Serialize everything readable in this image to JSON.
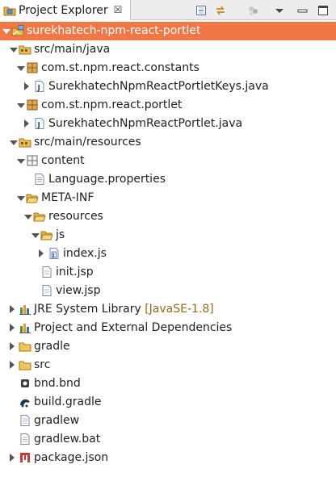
{
  "view": {
    "tab_title": "Project Explorer",
    "tab_close": "☒",
    "toolbar": [
      {
        "name": "collapse-all-button",
        "icon": "collapse-all-icon"
      },
      {
        "name": "link-with-editor-button",
        "icon": "link-editor-icon"
      },
      {
        "name": "focus-active-task-button",
        "icon": "task-focus-icon"
      },
      {
        "name": "view-menu-button",
        "icon": "chevron-down-icon"
      },
      {
        "name": "minimize-button",
        "icon": "minimize-icon"
      },
      {
        "name": "maximize-button",
        "icon": "maximize-icon"
      }
    ]
  },
  "tree": [
    {
      "label": "surekhatech-npm-react-portlet",
      "icon": "project-icon",
      "depth": 0,
      "state": "expanded",
      "selected": true
    },
    {
      "label": "src/main/java",
      "icon": "source-folder-icon",
      "depth": 1,
      "state": "expanded"
    },
    {
      "label": "com.st.npm.react.constants",
      "icon": "package-icon",
      "depth": 2,
      "state": "expanded"
    },
    {
      "label": "SurekhatechNpmReactPortletKeys.java",
      "icon": "java-file-icon",
      "depth": 3,
      "state": "collapsed"
    },
    {
      "label": "com.st.npm.react.portlet",
      "icon": "package-icon",
      "depth": 2,
      "state": "expanded"
    },
    {
      "label": "SurekhatechNpmReactPortlet.java",
      "icon": "java-file-icon",
      "depth": 3,
      "state": "collapsed"
    },
    {
      "label": "src/main/resources",
      "icon": "source-folder-icon",
      "depth": 1,
      "state": "expanded"
    },
    {
      "label": "content",
      "icon": "resource-package-icon",
      "depth": 2,
      "state": "expanded"
    },
    {
      "label": "Language.properties",
      "icon": "properties-file-icon",
      "depth": 3,
      "state": "none"
    },
    {
      "label": "META-INF",
      "icon": "folder-open-icon",
      "depth": 2,
      "state": "expanded"
    },
    {
      "label": "resources",
      "icon": "folder-open-icon",
      "depth": 3,
      "state": "expanded"
    },
    {
      "label": "js",
      "icon": "folder-open-icon",
      "depth": 4,
      "state": "expanded"
    },
    {
      "label": "index.js",
      "icon": "js-file-icon",
      "depth": 5,
      "state": "collapsed"
    },
    {
      "label": "init.jsp",
      "icon": "jsp-file-icon",
      "depth": 4,
      "state": "none"
    },
    {
      "label": "view.jsp",
      "icon": "jsp-file-icon",
      "depth": 4,
      "state": "none"
    },
    {
      "label": "JRE System Library",
      "decoration": "[JavaSE-1.8]",
      "icon": "library-icon",
      "depth": 1,
      "state": "collapsed"
    },
    {
      "label": "Project and External Dependencies",
      "icon": "library-icon",
      "depth": 1,
      "state": "collapsed"
    },
    {
      "label": "gradle",
      "icon": "folder-icon",
      "depth": 1,
      "state": "collapsed"
    },
    {
      "label": "src",
      "icon": "folder-icon",
      "depth": 1,
      "state": "collapsed"
    },
    {
      "label": "bnd.bnd",
      "icon": "bnd-file-icon",
      "depth": 1,
      "state": "none"
    },
    {
      "label": "build.gradle",
      "icon": "gradle-file-icon",
      "depth": 1,
      "state": "none"
    },
    {
      "label": "gradlew",
      "icon": "text-file-icon",
      "depth": 1,
      "state": "none"
    },
    {
      "label": "gradlew.bat",
      "icon": "text-file-icon",
      "depth": 1,
      "state": "none"
    },
    {
      "label": "package.json",
      "icon": "npm-file-icon",
      "depth": 1,
      "state": "collapsed"
    }
  ]
}
